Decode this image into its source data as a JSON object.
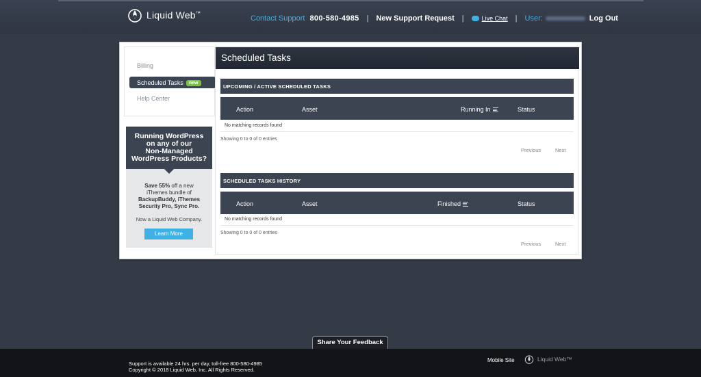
{
  "header": {
    "logo_text": "Liquid Web",
    "logo_tm": "™",
    "contact_label": "Contact Support",
    "phone": "800-580-4985",
    "sep1": "|",
    "new_request": "New Support Request",
    "sep2": "|",
    "live_chat": "Live Chat",
    "sep3": "|",
    "user_label": "User:",
    "logout": "Log Out"
  },
  "sidebar": {
    "items": [
      {
        "label": "Billing"
      },
      {
        "label": "Scheduled Tasks",
        "badge": "new"
      },
      {
        "label": "Help Center"
      }
    ]
  },
  "promo": {
    "headline_1": "Running WordPress",
    "headline_2": "on any of our",
    "headline_3": "Non-Managed",
    "headline_4": "WordPress Products?",
    "save_bold": "Save 55%",
    "save_rest": " off a new",
    "line2": "iThemes bundle of",
    "line3": "BackupBuddy, iThemes",
    "line4": "Security Pro, Sync Pro.",
    "company": "Now a Liquid Web Company.",
    "button": "Learn More"
  },
  "main": {
    "title": "Scheduled Tasks",
    "upcoming": {
      "heading": "UPCOMING / ACTIVE SCHEDULED TASKS",
      "columns": [
        "Action",
        "Asset",
        "Running In",
        "Status"
      ],
      "empty": "No matching records found",
      "showing": "Showing 0 to 0 of 0 entries",
      "prev": "Previous",
      "next": "Next"
    },
    "history": {
      "heading": "SCHEDULED TASKS HISTORY",
      "columns": [
        "Action",
        "Asset",
        "Finished",
        "Status"
      ],
      "empty": "No matching records found",
      "showing": "Showing 0 to 0 of 0 entries",
      "prev": "Previous",
      "next": "Next"
    }
  },
  "feedback": "Share Your Feedback",
  "footer": {
    "line1": "Support is available 24 hrs. per day, toll-free 800-580-4985",
    "line2": "Copyright © 2018 Liquid Web, Inc. All Rights Reserved.",
    "mobile": "Mobile Site",
    "logo_text": "Liquid Web™"
  },
  "colors": {
    "accent": "#3fb1e5",
    "dark_panel": "#3c4452",
    "background": "#353b46",
    "badge": "#7bc142"
  }
}
